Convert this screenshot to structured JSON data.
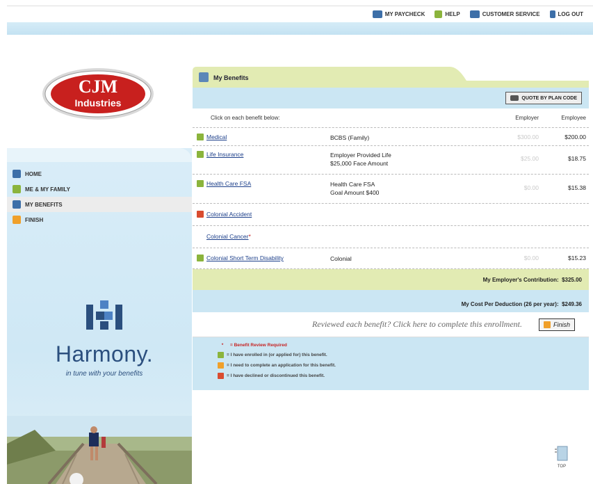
{
  "topbar": {
    "links": [
      {
        "label": "MY PAYCHECK",
        "icon": "paycheck-icon"
      },
      {
        "label": "HELP",
        "icon": "help-icon"
      },
      {
        "label": "CUSTOMER SERVICE",
        "icon": "customer-service-icon"
      },
      {
        "label": "LOG OUT",
        "icon": "logout-icon"
      }
    ]
  },
  "logo": {
    "line1": "CJM",
    "line2": "Industries"
  },
  "sidebar": {
    "items": [
      {
        "label": "HOME"
      },
      {
        "label": "ME & MY FAMILY"
      },
      {
        "label": "MY BENEFITS"
      },
      {
        "label": "FINISH"
      }
    ],
    "brand": {
      "name": "Harmony.",
      "tagline": "in tune with your benefits"
    }
  },
  "main": {
    "tab_title": "My Benefits",
    "quote_button": "QUOTE BY PLAN CODE",
    "instructions": "Click on each benefit below:",
    "col_employer": "Employer",
    "col_employee": "Employee",
    "rows": [
      {
        "status": "green",
        "name": "Medical",
        "desc1": "BCBS (Family)",
        "desc2": "",
        "employer": "$300.00",
        "employee": "$200.00"
      },
      {
        "status": "green",
        "name": "Life Insurance",
        "desc1": "Employer Provided Life",
        "desc2": "$25,000 Face Amount",
        "employer": "$25.00",
        "employee": "$18.75"
      },
      {
        "status": "green",
        "name": "Health Care FSA",
        "desc1": "Health Care FSA",
        "desc2": "Goal Amount $400",
        "employer": "$0.00",
        "employee": "$15.38"
      },
      {
        "status": "red",
        "name": "Colonial Accident",
        "desc1": "",
        "desc2": "",
        "employer": "",
        "employee": ""
      },
      {
        "status": "",
        "name": "Colonial Cancer",
        "required": "*",
        "desc1": "",
        "desc2": "",
        "employer": "",
        "employee": ""
      },
      {
        "status": "green",
        "name": "Colonial Short Term Disability",
        "desc1": "Colonial",
        "desc2": "",
        "employer": "$0.00",
        "employee": "$15.23"
      }
    ],
    "employer_contrib_label": "My Employer's Contribution:",
    "employer_contrib_value": "$325.00",
    "cost_label": "My Cost Per Deduction (26 per year):",
    "cost_value": "$249.36",
    "review_text": "Reviewed each benefit? Click here to complete this enrollment.",
    "finish_button": "Finish",
    "legend": {
      "required": "= Benefit Review Required",
      "enrolled": "= I have enrolled in (or applied for) this benefit.",
      "application": "= I need to complete an application for this benefit.",
      "declined": "= I have declined or discontinued this benefit."
    },
    "top_link": "TOP"
  },
  "colors": {
    "status_green": "#8bb43c",
    "status_red": "#d94c30",
    "status_orange": "#f0a02a",
    "accent_blue": "#cbe6f3",
    "accent_olive": "#e2ebb3"
  }
}
